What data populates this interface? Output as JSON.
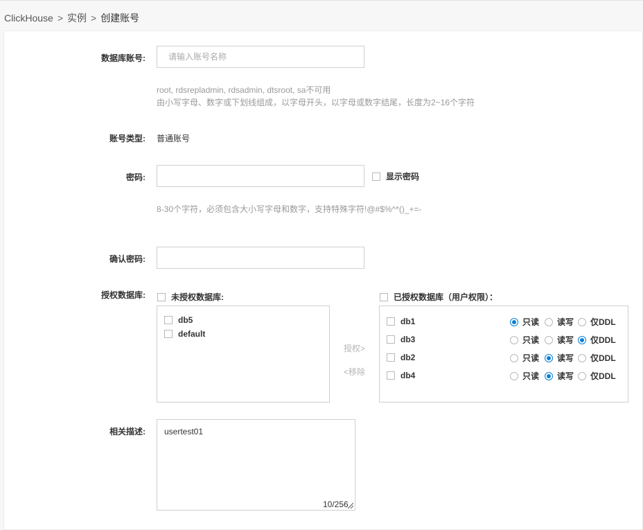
{
  "breadcrumb": {
    "root": "ClickHouse",
    "middle": "实例",
    "current": "创建账号",
    "separator": ">"
  },
  "form": {
    "account_label": "数据库账号:",
    "account_placeholder": "请输入账号名称",
    "account_value": "",
    "account_hint_1": "root, rdsrepladmin, rdsadmin, dtsroot, sa不可用",
    "account_hint_2": "由小写字母、数字或下划线组成，以字母开头，以字母或数字结尾，长度为2~16个字符",
    "type_label": "账号类型:",
    "type_value": "普通账号",
    "password_label": "密码:",
    "password_value": "",
    "show_password_label": "显示密码",
    "password_hint": "8-30个字符，必须包含大小写字母和数字，支持特殊字符!@#$%^*()_+=-",
    "confirm_label": "确认密码:",
    "confirm_value": "",
    "auth_label": "授权数据库:",
    "desc_label": "相关描述:",
    "desc_value": "usertest01",
    "desc_counter": "10/256"
  },
  "unauthorized": {
    "header": "未授权数据库:",
    "items": [
      {
        "name": "db5"
      },
      {
        "name": "default"
      }
    ]
  },
  "actions": {
    "grant": "授权>",
    "remove": "<移除"
  },
  "authorized": {
    "header": "已授权数据库（用户权限）：",
    "options": [
      "只读",
      "读写",
      "仅DDL"
    ],
    "items": [
      {
        "name": "db1",
        "selected": "只读"
      },
      {
        "name": "db3",
        "selected": "仅DDL"
      },
      {
        "name": "db2",
        "selected": "读写"
      },
      {
        "name": "db4",
        "selected": "读写"
      }
    ]
  },
  "colors": {
    "accent": "#0a7fd6",
    "border": "#cfcfcf",
    "hint": "#999999"
  }
}
